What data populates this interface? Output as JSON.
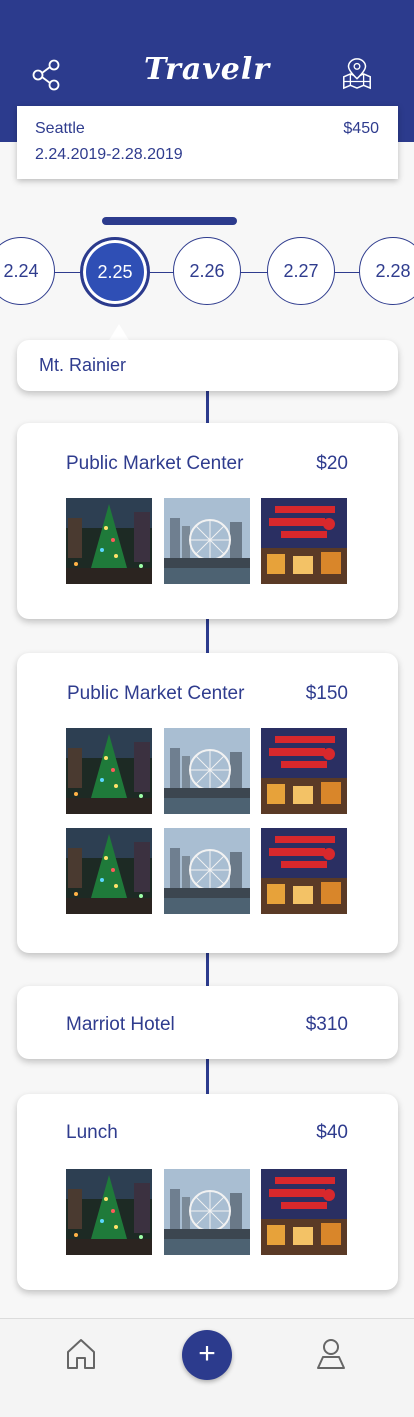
{
  "app": {
    "title": "Travelr"
  },
  "trip": {
    "city": "Seattle",
    "dates": "2.24.2019-2.28.2019",
    "price": "$450"
  },
  "dates": [
    "2.24",
    "2.25",
    "2.26",
    "2.27",
    "2.28"
  ],
  "selected_date": "2.25",
  "location": {
    "name": "Mt. Rainier"
  },
  "activities": [
    {
      "title": "Public Market Center",
      "price": "$20"
    },
    {
      "title": "Public Market Center",
      "price": "$150"
    },
    {
      "title": "Marriot Hotel",
      "price": "$310"
    },
    {
      "title": "Lunch",
      "price": "$40"
    }
  ],
  "photos": [
    {
      "icon": "christmas-tree-photo"
    },
    {
      "icon": "ferris-wheel-photo"
    },
    {
      "icon": "public-market-sign-photo"
    }
  ],
  "bottom_nav": {
    "home_icon": "home-icon",
    "add_label": "+",
    "profile_icon": "profile-icon"
  },
  "colors": {
    "primary": "#2c3b8d",
    "accent": "#2f4fb5",
    "background": "#f7f7f7"
  }
}
